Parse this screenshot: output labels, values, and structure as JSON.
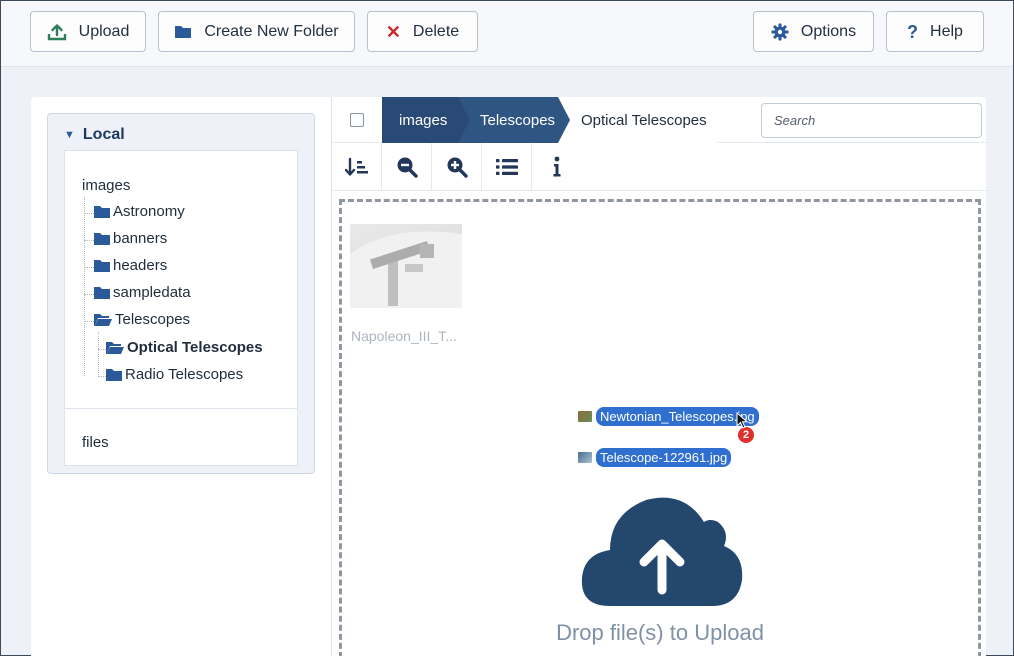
{
  "toolbar": {
    "upload_label": "Upload",
    "new_folder_label": "Create New Folder",
    "delete_label": "Delete",
    "options_label": "Options",
    "help_label": "Help"
  },
  "sidebar": {
    "title": "Local",
    "root": "images",
    "folders": [
      {
        "label": "Astronomy"
      },
      {
        "label": "banners"
      },
      {
        "label": "headers"
      },
      {
        "label": "sampledata"
      },
      {
        "label": "Telescopes"
      },
      {
        "label": "Optical Telescopes"
      },
      {
        "label": "Radio Telescopes"
      }
    ],
    "files_label": "files"
  },
  "breadcrumb": {
    "items": [
      "images",
      "Telescopes",
      "Optical Telescopes"
    ]
  },
  "search": {
    "placeholder": "Search"
  },
  "files": {
    "thumbnail_name": "Napoleon_III_T..."
  },
  "drag": {
    "files": [
      "Newtonian_Telescopes.jpg",
      "Telescope-122961.jpg"
    ],
    "count": "2"
  },
  "dropzone": {
    "text": "Drop file(s) to Upload"
  },
  "colors": {
    "accent": "#2b4f7b",
    "drag_pill": "#2f6fd0",
    "badge": "#e0302b"
  }
}
